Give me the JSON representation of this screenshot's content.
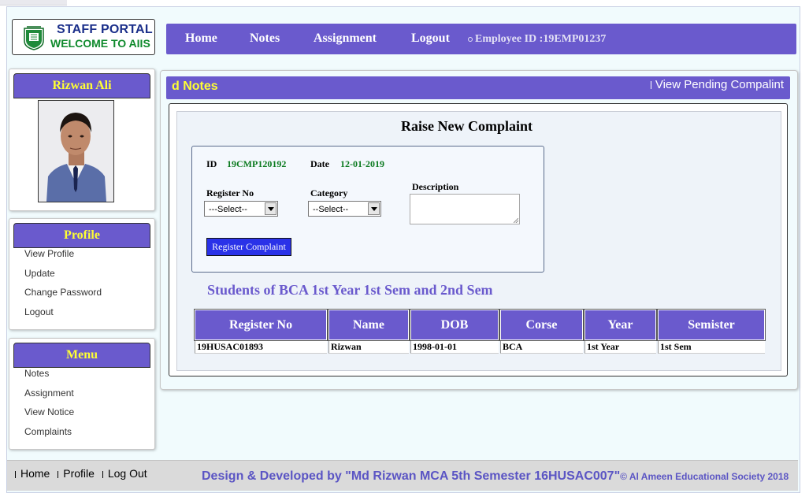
{
  "logo": {
    "line1": "STAFF PORTAL",
    "line2": "WELCOME TO AIIS"
  },
  "nav": {
    "home": "Home",
    "notes": "Notes",
    "assignment": "Assignment",
    "logout": "Logout",
    "employee_id": "Employee ID :19EMP01237"
  },
  "user": {
    "name": "Rizwan Ali"
  },
  "profile_panel": {
    "title": "Profile",
    "items": [
      "View Profile",
      "Update",
      "Change Password",
      "Logout"
    ]
  },
  "menu_panel": {
    "title": "Menu",
    "items": [
      "Notes",
      "Assignment",
      "View Notice",
      "Complaints"
    ]
  },
  "main": {
    "title": "d Notes",
    "pending_link": "View Pending Compalint"
  },
  "form": {
    "title": "Raise New Complaint",
    "id_label": "ID",
    "id_value": "19CMP120192",
    "date_label": "Date",
    "date_value": "12-01-2019",
    "register_label": "Register No",
    "register_selected": "---Select--",
    "category_label": "Category",
    "category_selected": "--Select--",
    "description_label": "Description",
    "submit_label": "Register Complaint"
  },
  "students": {
    "heading": "Students of BCA 1st Year 1st Sem and 2nd Sem",
    "columns": [
      "Register No",
      "Name",
      "DOB",
      "Corse",
      "Year",
      "Semister"
    ],
    "rows": [
      [
        "19HUSAC01893",
        "Rizwan",
        "1998-01-01",
        "BCA",
        "1st Year",
        "1st Sem"
      ]
    ]
  },
  "footer": {
    "links": [
      "Home",
      "Profile",
      "Log Out"
    ],
    "credit": "Design & Developed by \"Md Rizwan MCA 5th Semester 16HUSAC007\"",
    "copyright": "© Al Ameen Educational Society 2018"
  },
  "colors": {
    "accent": "#6a5acd",
    "heading_yellow": "#ffff33",
    "value_green": "#0b7a1f",
    "button_blue": "#2a32e8"
  }
}
